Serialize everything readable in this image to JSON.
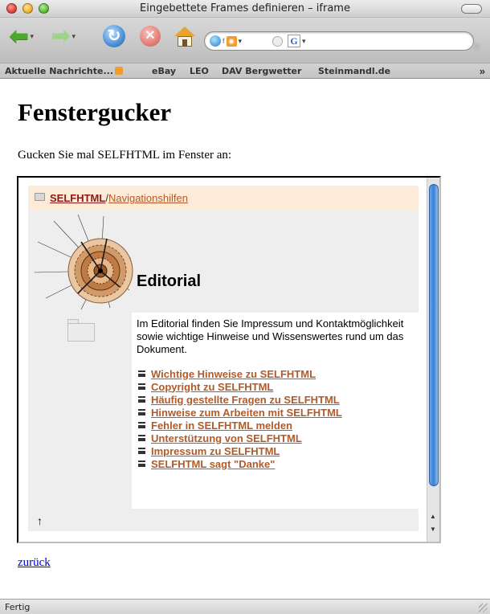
{
  "window": {
    "title": "Eingebettete Frames definieren – iframe"
  },
  "toolbar": {
    "back_icon": "back-arrow-icon",
    "forward_icon": "forward-arrow-icon",
    "reload_icon": "reload-icon",
    "stop_icon": "stop-icon",
    "home_icon": "home-icon",
    "search_engine_label": "G"
  },
  "bookmarks": {
    "items": [
      "Aktuelle Nachrichte...",
      "eBay",
      "LEO",
      "DAV Bergwetter",
      "Steinmandl.de"
    ],
    "more": "»"
  },
  "page": {
    "heading": "Fenstergucker",
    "intro": "Gucken Sie mal SELFHTML im Fenster an:",
    "back_link": "zurück"
  },
  "iframe": {
    "breadcrumb_main": "SELFHTML",
    "breadcrumb_sep": "/",
    "breadcrumb_sub": "Navigationshilfen",
    "heading": "Editorial",
    "description": "Im Editorial finden Sie Impressum und Kontaktmöglichkeit sowie wichtige Hinweise und Wissenswertes rund um das Dokument.",
    "links": [
      "Wichtige Hinweise zu SELFHTML",
      "Copyright zu SELFHTML",
      "Häufig gestellte Fragen zu SELFHTML",
      "Hinweise zum Arbeiten mit SELFHTML",
      "Fehler in SELFHTML melden",
      "Unterstützung von SELFHTML",
      "Impressum zu SELFHTML",
      "SELFHTML sagt \"Danke\""
    ],
    "up_arrow": "↑"
  },
  "status": {
    "text": "Fertig"
  },
  "colors": {
    "link_orange": "#b25a28",
    "breadcrumb_red": "#8b1a14",
    "nav_strip_bg": "#fdebd9",
    "page_link_blue": "#0000cc"
  }
}
